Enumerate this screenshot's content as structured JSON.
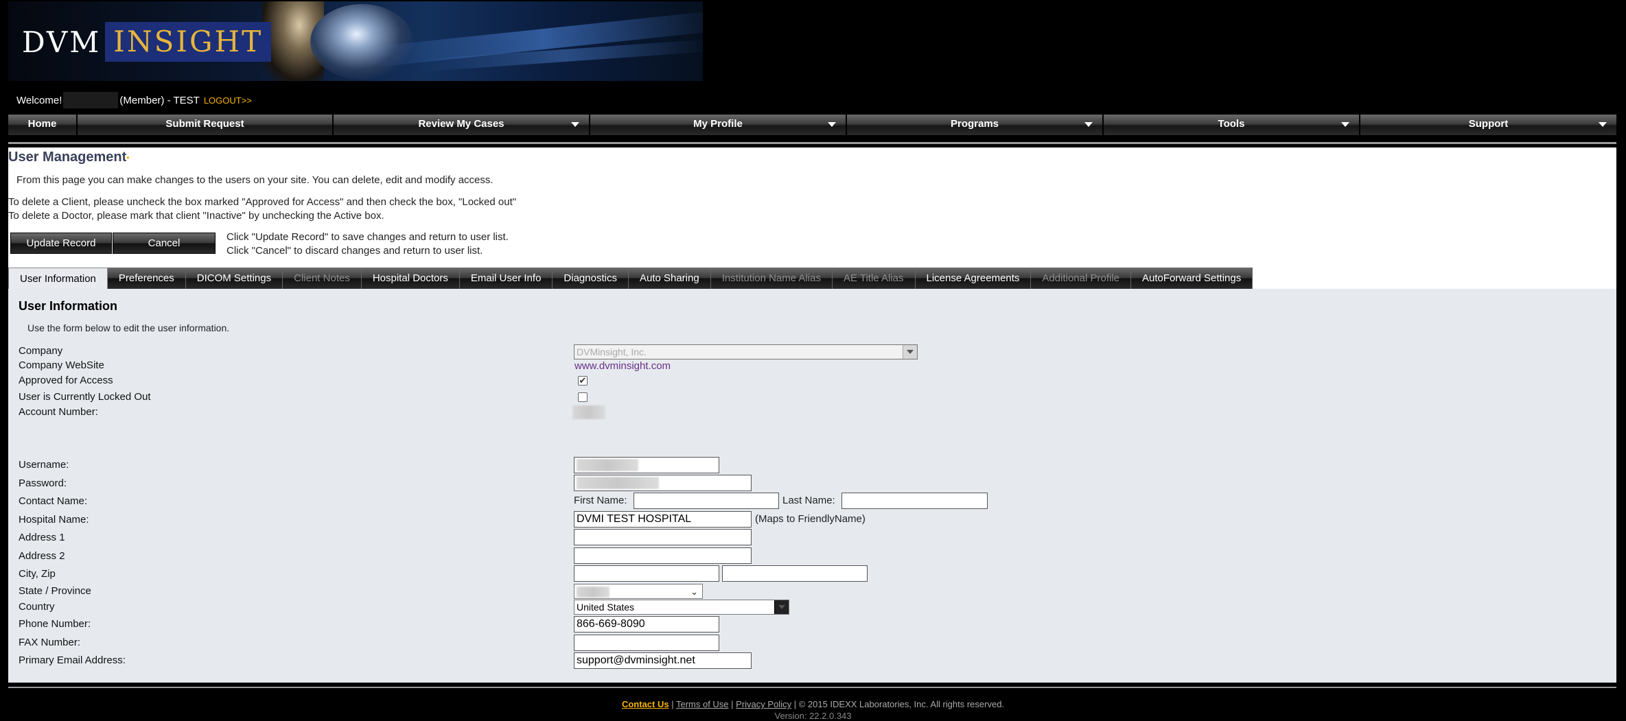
{
  "brand": {
    "logo_left": "DVM",
    "logo_right": "INSIGHT"
  },
  "welcome": {
    "prefix": "Welcome!",
    "role": "(Member) - TEST",
    "logout": "LOGOUT>>"
  },
  "nav": [
    {
      "label": "Home"
    },
    {
      "label": "Submit Request"
    },
    {
      "label": "Review My Cases",
      "dropdown": true
    },
    {
      "label": "My Profile",
      "dropdown": true
    },
    {
      "label": "Programs",
      "dropdown": true
    },
    {
      "label": "Tools",
      "dropdown": true
    },
    {
      "label": "Support",
      "dropdown": true
    }
  ],
  "page": {
    "title": "User Management",
    "intro": "From this page you can make changes to the users on your site. You can delete, edit and modify access.",
    "note1": "To delete a Client, please uncheck the box marked \"Approved for Access\" and then check the box, \"Locked out\"",
    "note2": "To delete a Doctor, please mark that client \"Inactive\" by unchecking the Active box.",
    "update_btn": "Update Record",
    "cancel_btn": "Cancel",
    "hint1": "Click \"Update Record\" to save changes and return to user list.",
    "hint2": "Click \"Cancel\" to discard changes and return to user list."
  },
  "tabs": [
    {
      "label": "User Information",
      "state": "active"
    },
    {
      "label": "Preferences",
      "state": "enabled"
    },
    {
      "label": "DICOM Settings",
      "state": "enabled"
    },
    {
      "label": "Client Notes",
      "state": "disabled"
    },
    {
      "label": "Hospital Doctors",
      "state": "enabled"
    },
    {
      "label": "Email User Info",
      "state": "enabled"
    },
    {
      "label": "Diagnostics",
      "state": "enabled"
    },
    {
      "label": "Auto Sharing",
      "state": "enabled"
    },
    {
      "label": "Institution Name Alias",
      "state": "disabled"
    },
    {
      "label": "AE Title Alias",
      "state": "disabled"
    },
    {
      "label": "License Agreements",
      "state": "enabled"
    },
    {
      "label": "Additional Profile",
      "state": "disabled"
    },
    {
      "label": "AutoForward Settings",
      "state": "enabled"
    }
  ],
  "form": {
    "title": "User Information",
    "subtitle": "Use the form below to edit the user information.",
    "labels": {
      "company": "Company",
      "website": "Company WebSite",
      "approved": "Approved for Access",
      "locked": "User is Currently Locked Out",
      "account": "Account Number:",
      "username": "Username:",
      "password": "Password:",
      "contact": "Contact Name:",
      "hospital": "Hospital Name:",
      "address1": "Address 1",
      "address2": "Address 2",
      "cityzip": "City, Zip",
      "state": "State / Province",
      "country": "Country",
      "phone": "Phone Number:",
      "fax": "FAX Number:",
      "email": "Primary Email Address:"
    },
    "company_value": "DVMinsight, Inc.",
    "website_value": "www.dvminsight.com",
    "approved_checked": true,
    "locked_checked": false,
    "first_name_label": "First Name:",
    "last_name_label": "Last Name:",
    "first_name": "",
    "last_name": "",
    "hospital_name": "DVMI TEST HOSPITAL",
    "hospital_note": "(Maps to FriendlyName)",
    "address1": "",
    "address2": "",
    "city": "",
    "zip": "",
    "country": "United States",
    "phone": "866-669-8090",
    "fax": "",
    "email": "support@dvminsight.net"
  },
  "footer": {
    "contact": "Contact Us",
    "terms": "Terms of Use",
    "privacy": "Privacy Policy",
    "copyright": "| © 2015 IDEXX Laboratories, Inc. All rights reserved.",
    "version": "Version: 22.2.0.343"
  },
  "colors": {
    "accent": "#f6b400",
    "title": "#39405a",
    "form_bg": "#e6eaef",
    "link": "#6b2f86"
  }
}
